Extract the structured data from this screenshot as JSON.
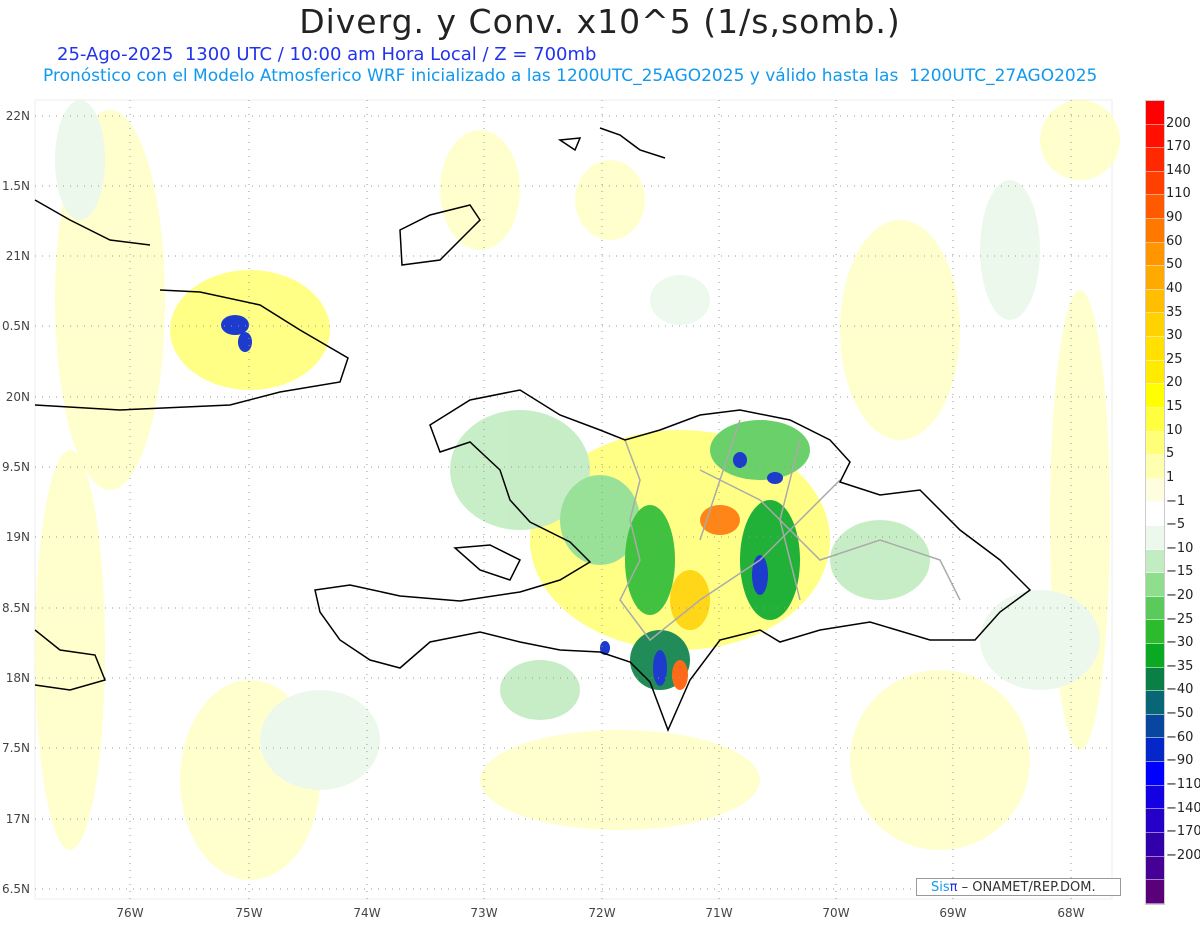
{
  "header": {
    "title": "Diverg. y Conv. x10^5 (1/s,somb.)",
    "subtitle_date": "25-Ago-2025  1300 UTC / 10:00 am Hora Local / Z = 700mb",
    "subtitle_model": "Pronóstico con el Modelo Atmosferico WRF inicializado a las 1200UTC_25AGO2025 y válido hasta las  1200UTC_27AGO2025"
  },
  "map": {
    "lat_labels": [
      "22N",
      "1.5N",
      "21N",
      "0.5N",
      "20N",
      "9.5N",
      "19N",
      "8.5N",
      "18N",
      "7.5N",
      "17N",
      "6.5N"
    ],
    "lon_labels": [
      "76W",
      "75W",
      "74W",
      "73W",
      "72W",
      "71W",
      "70W",
      "69W",
      "68W"
    ]
  },
  "colorbar": {
    "labels": [
      "200",
      "170",
      "140",
      "110",
      "90",
      "60",
      "50",
      "40",
      "35",
      "30",
      "25",
      "20",
      "15",
      "10",
      "5",
      "1",
      "−1",
      "−5",
      "−10",
      "−15",
      "−20",
      "−25",
      "−30",
      "−35",
      "−40",
      "−50",
      "−60",
      "−90",
      "−110",
      "−140",
      "−170",
      "−200"
    ],
    "colors": [
      "#ff0000",
      "#ff1000",
      "#ff2800",
      "#ff4000",
      "#ff5a00",
      "#ff7800",
      "#ff9600",
      "#ffaa00",
      "#ffbe00",
      "#ffd200",
      "#ffe000",
      "#ffea00",
      "#ffff00",
      "#ffff40",
      "#ffff78",
      "#ffffb0",
      "#fffde0",
      "#ffffff",
      "#ebf8eb",
      "#c2ecc2",
      "#8ede8e",
      "#5acb5a",
      "#2cbb2c",
      "#0aa823",
      "#0b8046",
      "#096674",
      "#0846a0",
      "#0526c8",
      "#0000ff",
      "#1400e0",
      "#2500c8",
      "#3200aa",
      "#460096",
      "#5a0078"
    ]
  },
  "credit": {
    "sis": "Sis",
    "pi": "π",
    "rest": " –  ONAMET/REP.DOM."
  }
}
